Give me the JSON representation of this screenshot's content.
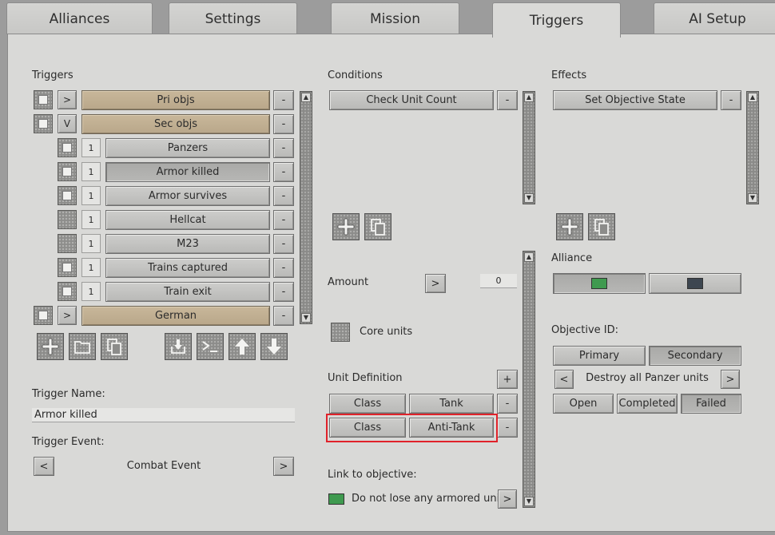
{
  "tabs": [
    "Alliances",
    "Settings",
    "Mission",
    "Triggers",
    "AI Setup"
  ],
  "triggers_panel": {
    "title": "Triggers",
    "rows": [
      {
        "toggle": ">",
        "count": "",
        "label": "Pri objs",
        "group": true
      },
      {
        "toggle": "V",
        "count": "",
        "label": "Sec objs",
        "group": true
      },
      {
        "toggle": "",
        "count": "1",
        "label": "Panzers",
        "group": false
      },
      {
        "toggle": "",
        "count": "1",
        "label": "Armor killed",
        "group": false
      },
      {
        "toggle": "",
        "count": "1",
        "label": "Armor survives",
        "group": false
      },
      {
        "toggle": "",
        "count": "1",
        "label": "Hellcat",
        "group": false
      },
      {
        "toggle": "",
        "count": "1",
        "label": "M23",
        "group": false
      },
      {
        "toggle": "",
        "count": "1",
        "label": "Trains captured",
        "group": false
      },
      {
        "toggle": "",
        "count": "1",
        "label": "Train exit",
        "group": false
      },
      {
        "toggle": ">",
        "count": "",
        "label": "German",
        "group": true
      }
    ],
    "remove_label": "-",
    "trigger_name_label": "Trigger Name:",
    "trigger_name_value": "Armor killed",
    "trigger_event_label": "Trigger Event:",
    "trigger_event_value": "Combat Event",
    "prev": "<",
    "next": ">"
  },
  "conditions": {
    "title": "Conditions",
    "items": [
      "Check Unit Count"
    ],
    "remove_label": "-",
    "amount_label": "Amount",
    "amount_op": ">",
    "amount_value": "0",
    "core_units_label": "Core units",
    "unit_definition_label": "Unit Definition",
    "add_label": "+",
    "unit_defs": [
      {
        "key": "Class",
        "value": "Tank"
      },
      {
        "key": "Class",
        "value": "Anti-Tank"
      }
    ],
    "link_label": "Link to objective:",
    "link_value": "Do not lose any armored units",
    "link_next": ">",
    "link_color": "#3f9a4f"
  },
  "effects": {
    "title": "Effects",
    "items": [
      "Set Objective State"
    ],
    "remove_label": "-",
    "alliance_label": "Alliance",
    "alliance_colors": [
      "#3f9a4f",
      "#3d4650"
    ],
    "objective_id_label": "Objective ID:",
    "primary": "Primary",
    "secondary": "Secondary",
    "objective_prev": "<",
    "objective_name": "Destroy all Panzer units",
    "objective_next": ">",
    "states": [
      "Open",
      "Completed",
      "Failed"
    ]
  },
  "icons": [
    "add-icon",
    "folder-icon",
    "copy-icon",
    "import-icon",
    "console-icon",
    "arrow-up-icon",
    "arrow-down-icon"
  ]
}
